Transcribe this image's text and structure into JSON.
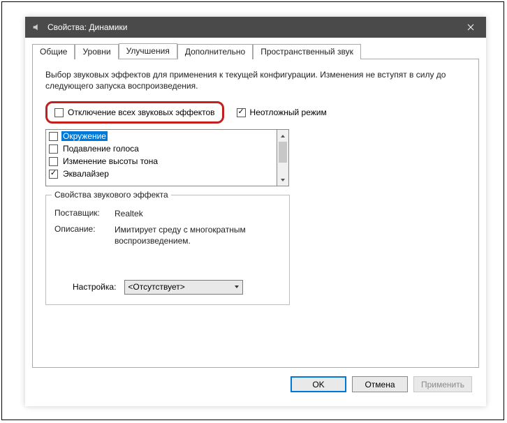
{
  "titlebar": {
    "title": "Свойства: Динамики"
  },
  "tabs": {
    "general": "Общие",
    "levels": "Уровни",
    "enhancements": "Улучшения",
    "advanced": "Дополнительно",
    "spatial": "Пространственный звук"
  },
  "panel": {
    "description": "Выбор звуковых эффектов для применения к текущей конфигурации. Изменения не вступят в силу до следующего запуска воспроизведения.",
    "disable_all_label": "Отключение всех звуковых эффектов",
    "immediate_label": "Неотложный режим",
    "effects": [
      {
        "label": "Окружение",
        "checked": false,
        "selected": true
      },
      {
        "label": "Подавление голоса",
        "checked": false,
        "selected": false
      },
      {
        "label": "Изменение высоты тона",
        "checked": false,
        "selected": false
      },
      {
        "label": "Эквалайзер",
        "checked": true,
        "selected": false
      }
    ],
    "group_title": "Свойства звукового эффекта",
    "vendor_label": "Поставщик:",
    "vendor_value": "Realtek",
    "desc_label": "Описание:",
    "desc_value": "Имитирует среду с многократным воспроизведением.",
    "setting_label": "Настройка:",
    "setting_value": "<Отсутствует>"
  },
  "buttons": {
    "ok": "OK",
    "cancel": "Отмена",
    "apply": "Применить"
  }
}
